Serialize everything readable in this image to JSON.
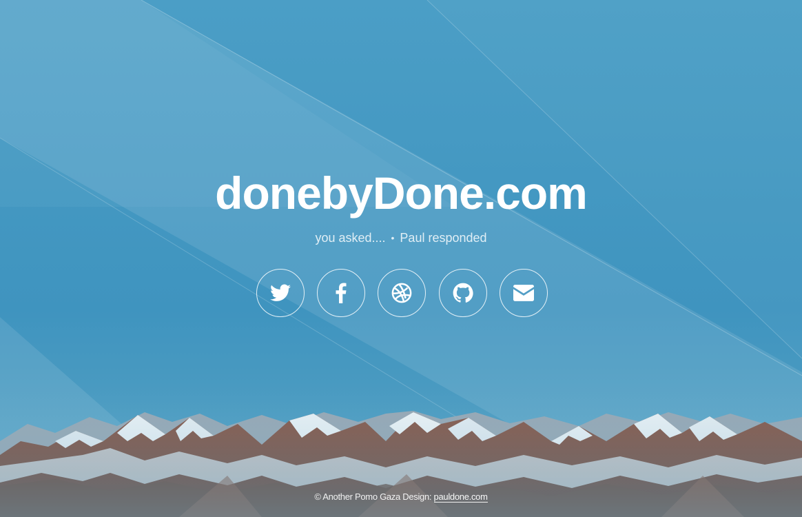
{
  "site": {
    "title": "donebyDone.com",
    "tagline_left": "you asked....",
    "tagline_separator": "•",
    "tagline_right": "Paul responded"
  },
  "social_links": [
    {
      "name": "twitter",
      "icon": "twitter-icon"
    },
    {
      "name": "facebook",
      "icon": "facebook-icon"
    },
    {
      "name": "dribbble",
      "icon": "dribbble-icon"
    },
    {
      "name": "github",
      "icon": "github-icon"
    },
    {
      "name": "email",
      "icon": "envelope-icon"
    }
  ],
  "footer": {
    "prefix": "© Another Pomo Gaza Design: ",
    "link_text": "pauldone.com"
  },
  "colors": {
    "sky": "#3f97c2",
    "text": "#ffffff"
  }
}
